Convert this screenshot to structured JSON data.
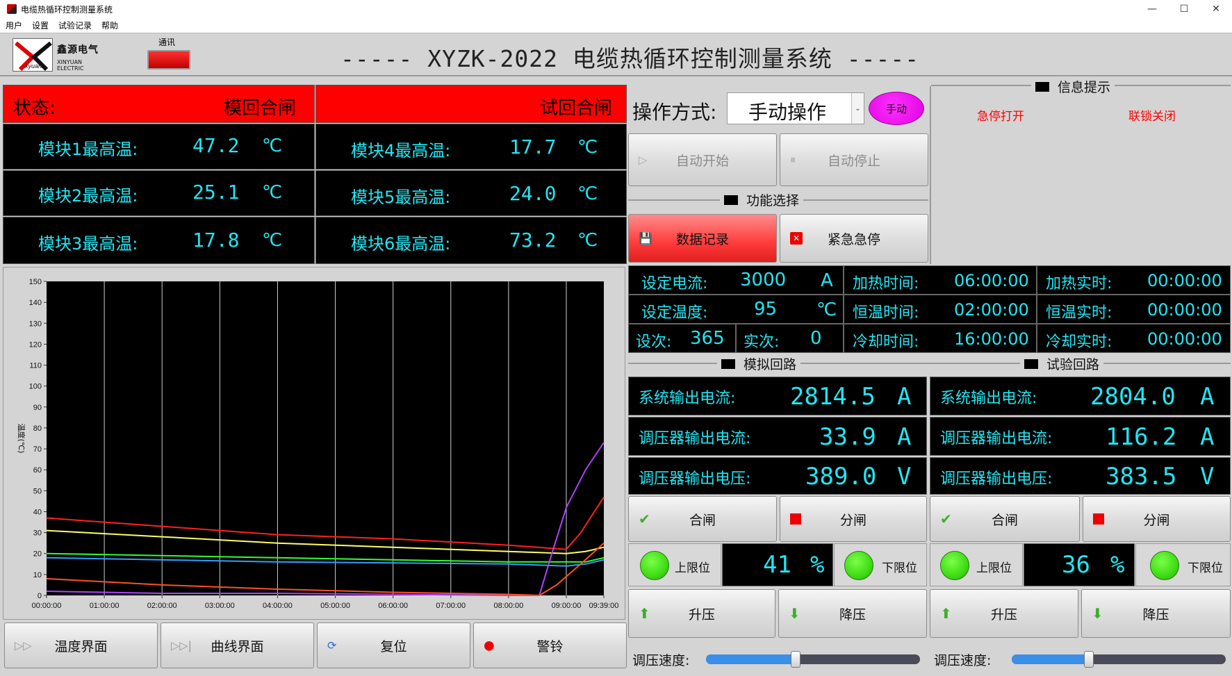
{
  "window": {
    "title": "电缆热循环控制测量系统",
    "minimize": "—",
    "maximize": "☐",
    "close": "✕"
  },
  "menu": [
    "用户",
    "设置",
    "试验记录",
    "帮助"
  ],
  "header": {
    "brand_cn": "鑫源电气",
    "brand_en": "XINYUAN ELECTRIC",
    "logo_text": "xyuan",
    "comm_label": "通讯",
    "title": "----- XYZK-2022 电缆热循环控制测量系统 -----"
  },
  "temps": {
    "status_label": "状态:",
    "left_status": "模回合闸",
    "right_status": "试回合闸",
    "unit": "℃",
    "modules": [
      {
        "label": "模块1最高温:",
        "value": "47.2"
      },
      {
        "label": "模块2最高温:",
        "value": "25.1"
      },
      {
        "label": "模块3最高温:",
        "value": "17.8"
      },
      {
        "label": "模块4最高温:",
        "value": "17.7"
      },
      {
        "label": "模块5最高温:",
        "value": "24.0"
      },
      {
        "label": "模块6最高温:",
        "value": "73.2"
      }
    ]
  },
  "chart_data": {
    "type": "line",
    "ylabel": "温度(℃)",
    "ylim": [
      0,
      150
    ],
    "yticks": [
      0,
      10,
      20,
      30,
      40,
      50,
      60,
      70,
      80,
      90,
      100,
      110,
      120,
      130,
      140,
      150
    ],
    "xticks": [
      "00:00:00",
      "01:00:00",
      "02:00:00",
      "03:00:00",
      "04:00:00",
      "05:00:00",
      "06:00:00",
      "07:00:00",
      "08:00:00",
      "09:00:00",
      "09:39:00"
    ],
    "xlim_minutes": [
      0,
      579
    ],
    "grid": true,
    "series": [
      {
        "color": "#ff2020",
        "points": [
          [
            0,
            37
          ],
          [
            120,
            33
          ],
          [
            240,
            29
          ],
          [
            360,
            27
          ],
          [
            480,
            24
          ],
          [
            540,
            22
          ],
          [
            555,
            30
          ],
          [
            579,
            47
          ]
        ]
      },
      {
        "color": "#ffff60",
        "points": [
          [
            0,
            31
          ],
          [
            120,
            28
          ],
          [
            240,
            25
          ],
          [
            360,
            23
          ],
          [
            480,
            21
          ],
          [
            540,
            20
          ],
          [
            560,
            21
          ],
          [
            579,
            23
          ]
        ]
      },
      {
        "color": "#30ff30",
        "points": [
          [
            0,
            20
          ],
          [
            120,
            19
          ],
          [
            240,
            18
          ],
          [
            360,
            17
          ],
          [
            480,
            16
          ],
          [
            540,
            16
          ],
          [
            560,
            16
          ],
          [
            579,
            18
          ]
        ]
      },
      {
        "color": "#30a0ff",
        "points": [
          [
            0,
            18
          ],
          [
            120,
            17
          ],
          [
            240,
            16
          ],
          [
            360,
            15.5
          ],
          [
            480,
            15
          ],
          [
            540,
            14
          ],
          [
            560,
            15
          ],
          [
            579,
            17
          ]
        ]
      },
      {
        "color": "#b040ff",
        "points": [
          [
            0,
            2
          ],
          [
            120,
            1
          ],
          [
            240,
            1
          ],
          [
            360,
            0.5
          ],
          [
            480,
            0
          ],
          [
            512,
            0
          ],
          [
            525,
            20
          ],
          [
            540,
            42
          ],
          [
            560,
            60
          ],
          [
            579,
            73
          ]
        ]
      },
      {
        "color": "#ff5020",
        "points": [
          [
            0,
            8
          ],
          [
            120,
            5
          ],
          [
            240,
            3
          ],
          [
            360,
            1.5
          ],
          [
            480,
            0.5
          ],
          [
            512,
            0
          ],
          [
            530,
            5
          ],
          [
            555,
            15
          ],
          [
            579,
            25
          ]
        ]
      }
    ]
  },
  "bottom_nav": {
    "temp_view": "温度界面",
    "curve_view": "曲线界面",
    "reset": "复位",
    "alarm": "警铃"
  },
  "operation": {
    "label": "操作方式:",
    "mode_value": "手动操作",
    "mode_badge": "手动",
    "auto_start": "自动开始",
    "auto_stop": "自动停止"
  },
  "function_select": {
    "title": "功能选择",
    "data_record": "数据记录",
    "emergency_stop": "紧急急停"
  },
  "info": {
    "title": "信息提示",
    "msg1": "急停打开",
    "msg2": "联锁关闭",
    "msg_color": "#ff0000"
  },
  "params": {
    "set_current_label": "设定电流:",
    "set_current": "3000",
    "set_current_unit": "A",
    "set_temp_label": "设定温度:",
    "set_temp": "95",
    "set_temp_unit": "℃",
    "set_count_label": "设次:",
    "set_count": "365",
    "real_count_label": "实次:",
    "real_count": "0",
    "heat_time_label": "加热时间:",
    "heat_time": "06:00:00",
    "hold_time_label": "恒温时间:",
    "hold_time": "02:00:00",
    "cool_time_label": "冷却时间:",
    "cool_time": "16:00:00",
    "heat_real_label": "加热实时:",
    "heat_real": "00:00:00",
    "hold_real_label": "恒温实时:",
    "hold_real": "00:00:00",
    "cool_real_label": "冷却实时:",
    "cool_real": "00:00:00"
  },
  "sim_loop": {
    "title": "模拟回路",
    "rows": [
      {
        "label": "系统输出电流:",
        "value": "2814.5",
        "unit": "A"
      },
      {
        "label": "调压器输出电流:",
        "value": "33.9",
        "unit": "A"
      },
      {
        "label": "调压器输出电压:",
        "value": "389.0",
        "unit": "V"
      }
    ],
    "close_btn": "合闸",
    "open_btn": "分闸",
    "upper_limit": "上限位",
    "lower_limit": "下限位",
    "percent": "41",
    "percent_unit": "%",
    "raise_btn": "升压",
    "lower_btn": "降压",
    "speed_label": "调压速度:",
    "speed_fraction": 0.42
  },
  "test_loop": {
    "title": "试验回路",
    "rows": [
      {
        "label": "系统输出电流:",
        "value": "2804.0",
        "unit": "A"
      },
      {
        "label": "调压器输出电流:",
        "value": "116.2",
        "unit": "A"
      },
      {
        "label": "调压器输出电压:",
        "value": "383.5",
        "unit": "V"
      }
    ],
    "close_btn": "合闸",
    "open_btn": "分闸",
    "upper_limit": "上限位",
    "lower_limit": "下限位",
    "percent": "36",
    "percent_unit": "%",
    "raise_btn": "升压",
    "lower_btn": "降压",
    "speed_label": "调压速度:",
    "speed_fraction": 0.36
  }
}
